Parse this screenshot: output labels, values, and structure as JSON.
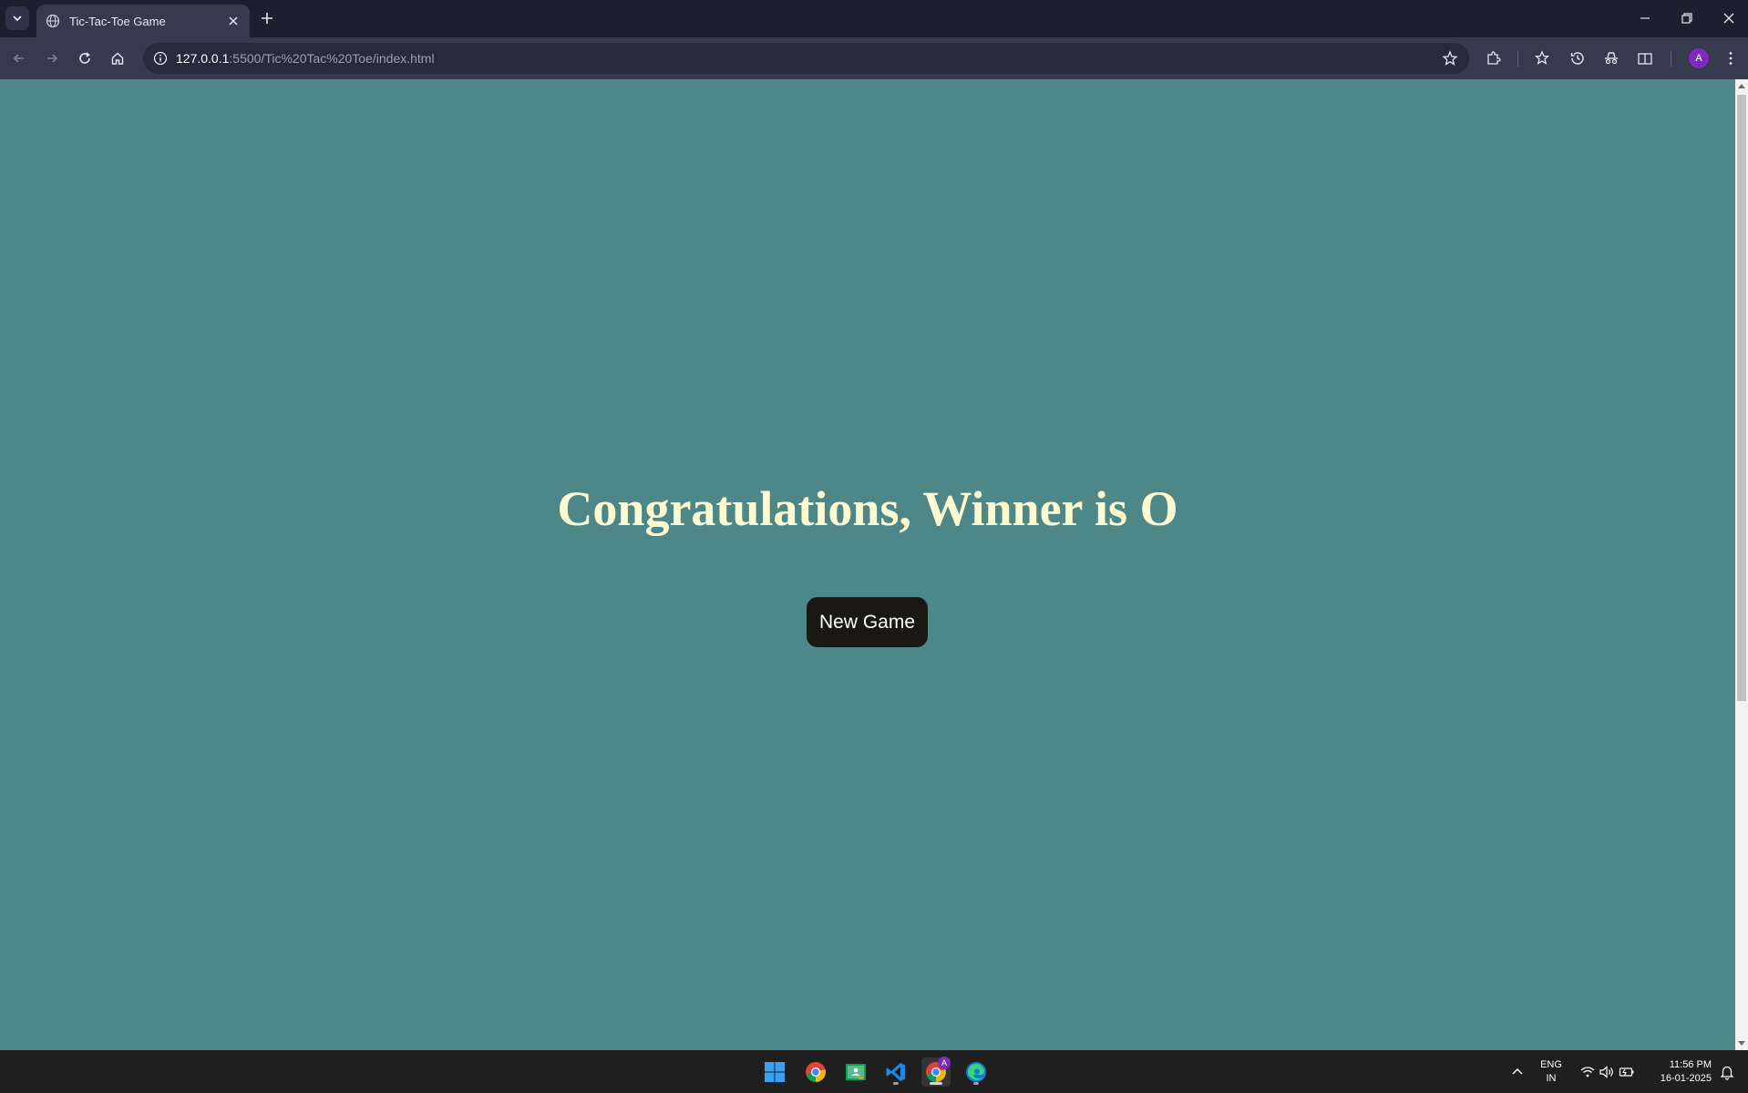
{
  "browser": {
    "tab_title": "Tic-Tac-Toe Game",
    "url_host": "127.0.0.1",
    "url_rest": ":5500/Tic%20Tac%20Toe/index.html",
    "profile_initial": "A"
  },
  "page": {
    "message": "Congratulations, Winner is O",
    "new_game_label": "New Game",
    "background": "#4e8787",
    "message_color": "#fffbd0",
    "button_color": "#1a1813"
  },
  "taskbar": {
    "language_primary": "ENG",
    "language_secondary": "IN",
    "time": "11:56 PM",
    "date": "16-01-2025",
    "chrome_badge": "A"
  }
}
